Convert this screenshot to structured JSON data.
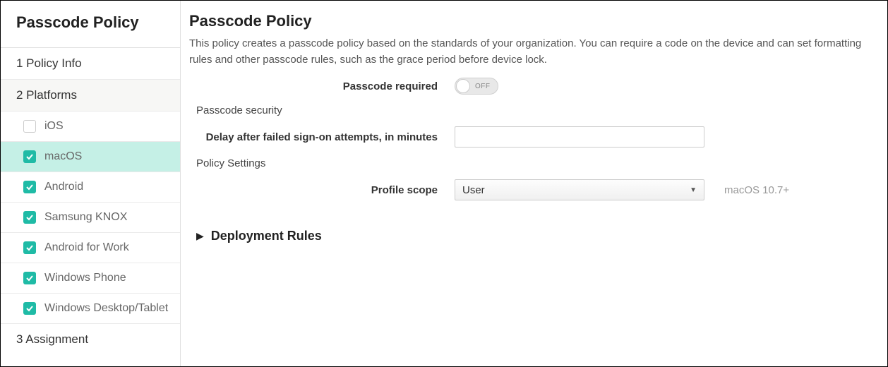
{
  "sidebar": {
    "title": "Passcode Policy",
    "steps": {
      "policy_info": "1  Policy Info",
      "platforms": "2  Platforms",
      "assignment": "3  Assignment"
    },
    "platforms": [
      {
        "label": "iOS",
        "checked": false,
        "selected": false
      },
      {
        "label": "macOS",
        "checked": true,
        "selected": true
      },
      {
        "label": "Android",
        "checked": true,
        "selected": false
      },
      {
        "label": "Samsung KNOX",
        "checked": true,
        "selected": false
      },
      {
        "label": "Android for Work",
        "checked": true,
        "selected": false
      },
      {
        "label": "Windows Phone",
        "checked": true,
        "selected": false
      },
      {
        "label": "Windows Desktop/Tablet",
        "checked": true,
        "selected": false
      }
    ]
  },
  "main": {
    "title": "Passcode Policy",
    "description": "This policy creates a passcode policy based on the standards of your organization. You can require a code on the device and can set formatting rules and other passcode rules, such as the grace period before device lock.",
    "passcode_required_label": "Passcode required",
    "passcode_required_value": "OFF",
    "section_security": "Passcode security",
    "delay_label": "Delay after failed sign-on attempts, in minutes",
    "delay_value": "",
    "section_policy_settings": "Policy Settings",
    "profile_scope_label": "Profile scope",
    "profile_scope_value": "User",
    "profile_scope_hint": "macOS 10.7+",
    "deployment_rules": "Deployment Rules"
  }
}
